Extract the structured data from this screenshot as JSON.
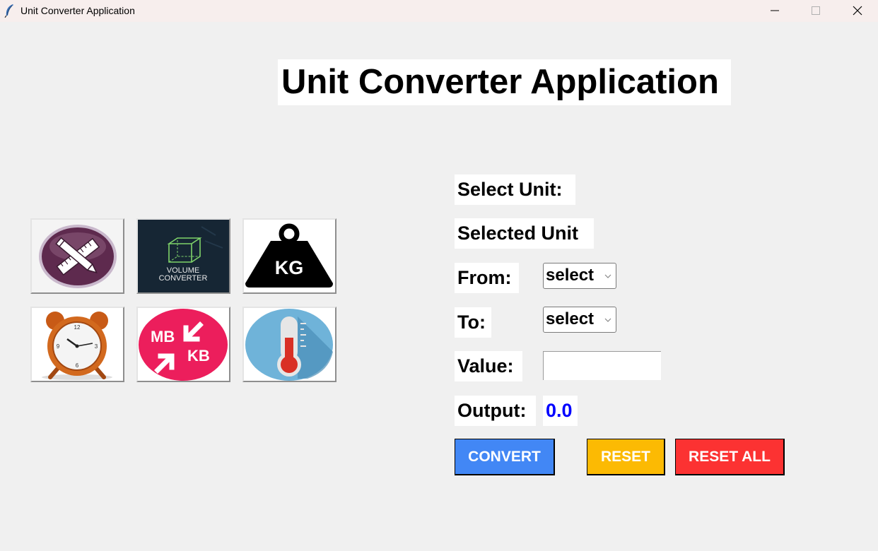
{
  "window": {
    "title": "Unit Converter Application"
  },
  "heading": "Unit Converter Application",
  "unit_buttons": [
    {
      "name": "length",
      "icon": "ruler-pencil-icon"
    },
    {
      "name": "volume",
      "icon": "volume-cube-icon",
      "text_line1": "VOLUME",
      "text_line2": "CONVERTER"
    },
    {
      "name": "weight",
      "icon": "kg-weight-icon",
      "text": "KG"
    },
    {
      "name": "time",
      "icon": "alarm-clock-icon"
    },
    {
      "name": "data",
      "icon": "mb-kb-icon",
      "text_mb": "MB",
      "text_kb": "KB"
    },
    {
      "name": "temperature",
      "icon": "thermometer-icon"
    }
  ],
  "form": {
    "select_unit_label": "Select Unit:",
    "selected_unit_label": "Selected Unit",
    "from_label": "From:",
    "from_value": "select",
    "to_label": "To:",
    "to_value": "select",
    "value_label": "Value:",
    "value_input": "",
    "output_label": "Output:",
    "output_value": "0.0"
  },
  "buttons": {
    "convert": "CONVERT",
    "reset": "RESET",
    "reset_all": "RESET ALL"
  },
  "colors": {
    "convert": "#4287f5",
    "reset": "#fcba03",
    "reset_all": "#fc3232",
    "output": "#0000ff"
  }
}
